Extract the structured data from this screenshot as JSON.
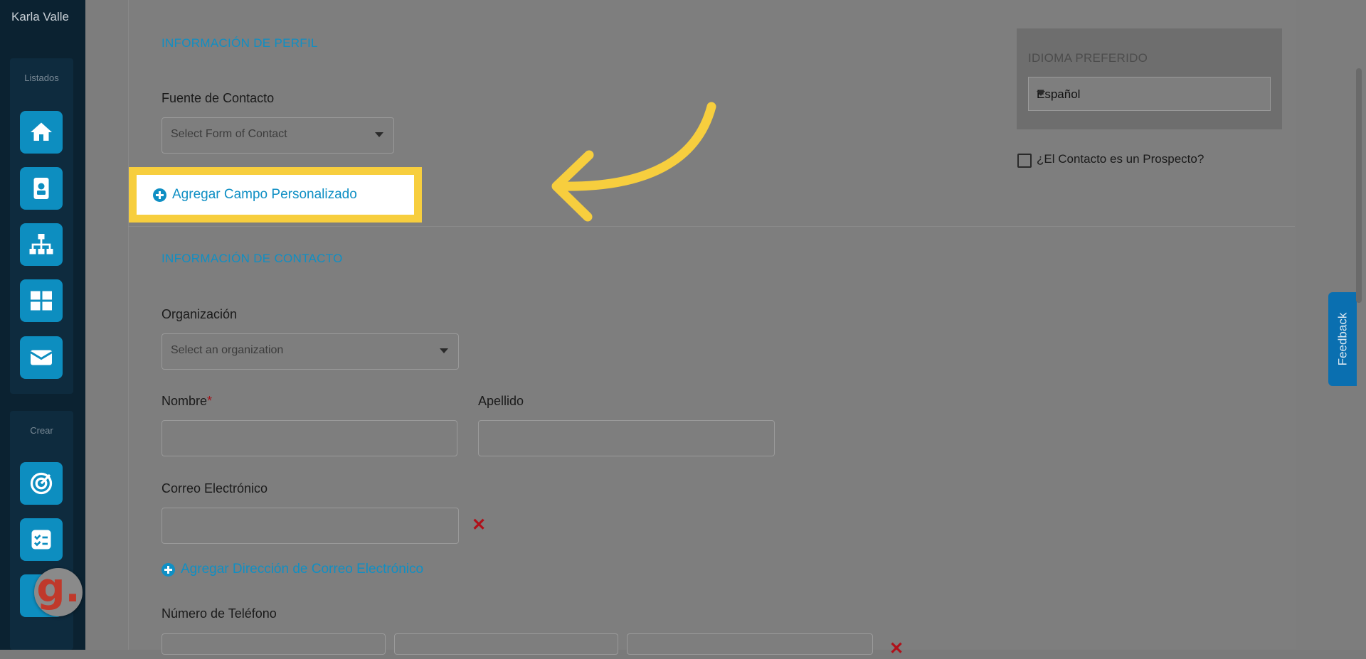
{
  "sidebar": {
    "user_name": "Karla Valle",
    "group_listados": "Listados",
    "group_crear": "Crear",
    "listados_icons": [
      "home-icon",
      "contact-card-icon",
      "org-chart-icon",
      "dashboard-icon",
      "mail-icon"
    ],
    "crear_icons": [
      "target-icon",
      "checklist-icon"
    ]
  },
  "profile": {
    "section_title": "INFORMACIÓN DE PERFIL",
    "source_label": "Fuente de Contacto",
    "source_placeholder": "Select Form of Contact",
    "add_custom_field": "Agregar Campo Personalizado"
  },
  "language": {
    "title": "IDIOMA PREFERIDO",
    "value": "Español",
    "prospect_label": "¿El Contacto es un Prospecto?"
  },
  "contact": {
    "section_title": "INFORMACIÓN DE CONTACTO",
    "org_label": "Organización",
    "org_placeholder": "Select an organization",
    "first_name_label": "Nombre",
    "required_mark": "*",
    "last_name_label": "Apellido",
    "email_label": "Correo Electrónico",
    "add_email": "Agregar Dirección de Correo Electrónico",
    "phone_label": "Número de Teléfono"
  },
  "feedback_label": "Feedback",
  "colors": {
    "accent": "#0f8fc4",
    "highlight": "#f7ce3e",
    "sidebar": "#0b2231",
    "danger": "#b0111a"
  }
}
